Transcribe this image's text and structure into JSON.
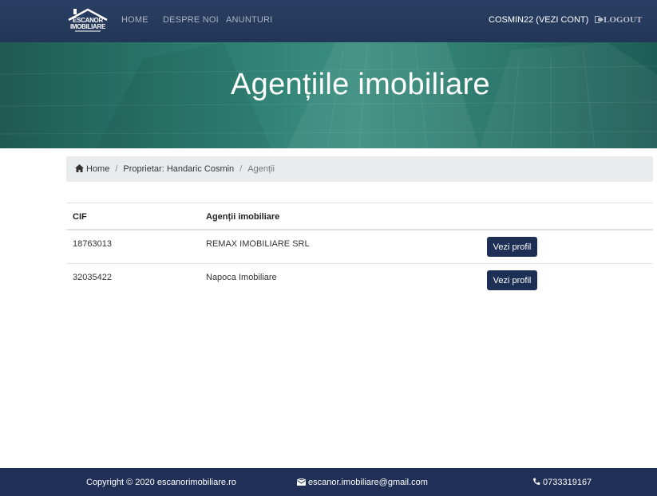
{
  "brand": {
    "logo_text_line1": "ESCANOR",
    "logo_text_line2": "IMOBILIARE"
  },
  "nav": {
    "items": [
      {
        "label": "HOME"
      },
      {
        "label": "DESPRE NOI"
      },
      {
        "label": "ANUNTURI"
      }
    ],
    "account_label": "COSMIN22 (VEZI CONT)",
    "logout_label": "LOGOUT"
  },
  "hero": {
    "title": "Agențiile imobiliare"
  },
  "breadcrumb": {
    "items": [
      {
        "label": "Home"
      },
      {
        "label": "Proprietar: Handaric Cosmin"
      }
    ],
    "active": "Agenții"
  },
  "table": {
    "headers": {
      "cif": "CIF",
      "agency": "Agenții imobiliare"
    },
    "rows": [
      {
        "cif": "18763013",
        "agency": "REMAX IMOBILIARE SRL",
        "action": "Vezi profil"
      },
      {
        "cif": "32035422",
        "agency": "Napoca Imobiliare",
        "action": "Vezi profil"
      }
    ]
  },
  "footer": {
    "copyright": "Copyright © 2020 escanorimobiliare.ro",
    "email": "escanor.imobiliare@gmail.com",
    "phone": "0733319167"
  },
  "colors": {
    "navbar": "#253858",
    "hero": "#2e7f72",
    "button": "#1e2f55",
    "footer": "#1f2f55"
  },
  "icons": [
    "logo-house-icon",
    "logout-icon",
    "home-icon",
    "envelope-icon",
    "phone-icon"
  ]
}
